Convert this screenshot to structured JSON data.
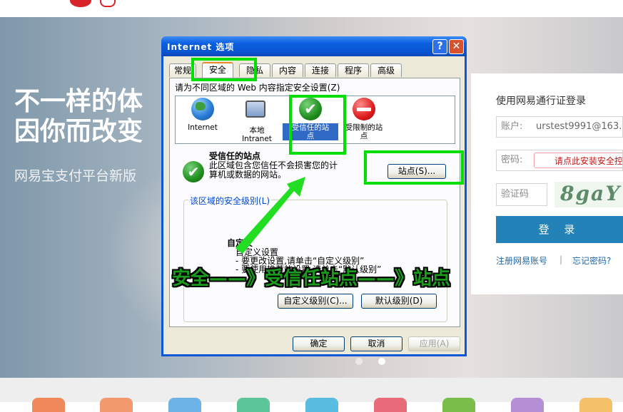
{
  "hero": {
    "headline_line1": "不一样的体",
    "headline_line2": "因你而改变",
    "subline": "网易宝支付平台新版"
  },
  "login": {
    "title": "使用网易通行证登录",
    "account_label": "账户:",
    "account_value": "urstest9991@163.c",
    "password_label": "密码:",
    "password_warning": "请点此安装安全控",
    "captcha_label": "验证码",
    "captcha_text": "8gaY",
    "submit_label": "登 录",
    "register_link": "注册网易账号",
    "separator": "|",
    "forgot_link": "忘记密码?"
  },
  "dialog": {
    "title": "Internet 选项",
    "help_glyph": "?",
    "close_glyph": "✕",
    "tabs": [
      {
        "label": "常规"
      },
      {
        "label": "安全"
      },
      {
        "label": "隐私"
      },
      {
        "label": "内容"
      },
      {
        "label": "连接"
      },
      {
        "label": "程序"
      },
      {
        "label": "高级"
      }
    ],
    "active_tab": "安全",
    "instruction": "请为不同区域的 Web 内容指定安全设置(Z)",
    "zones": [
      {
        "line1": "Internet",
        "line2": ""
      },
      {
        "line1": "本地",
        "line2": "Intranet"
      },
      {
        "line1": "受信任的站",
        "line2": "点"
      },
      {
        "line1": "受限制的站",
        "line2": "点"
      }
    ],
    "zone_title": "受信任的站点",
    "zone_desc_line1": "此区域包含您信任不会损害您的计",
    "zone_desc_line2": "算机或数据的网站。",
    "sites_button": "站点(S)...",
    "group_legend": "该区域的安全级别(L)",
    "custom_title": "自定义",
    "custom_line1": "自定义设置",
    "custom_line2": "- 要更改设置,请单击“自定义级别”",
    "custom_line3": "- 要使用推荐的设置,请单击“默认级别”",
    "custom_level_button": "自定义级别(C)...",
    "default_level_button": "默认级别(D)",
    "ok_button": "确定",
    "cancel_button": "取消",
    "apply_button": "应用(A)"
  },
  "annotation": {
    "text": "安全——》受信任站点——》站点",
    "color": "#1b9b1b",
    "highlight_color": "#00e000"
  },
  "colors": {
    "titlebar": "#0a54d0",
    "dialog_bg": "#ece9d8",
    "login_button": "#2383b8",
    "link": "#2368a8",
    "warning": "#c01818"
  }
}
